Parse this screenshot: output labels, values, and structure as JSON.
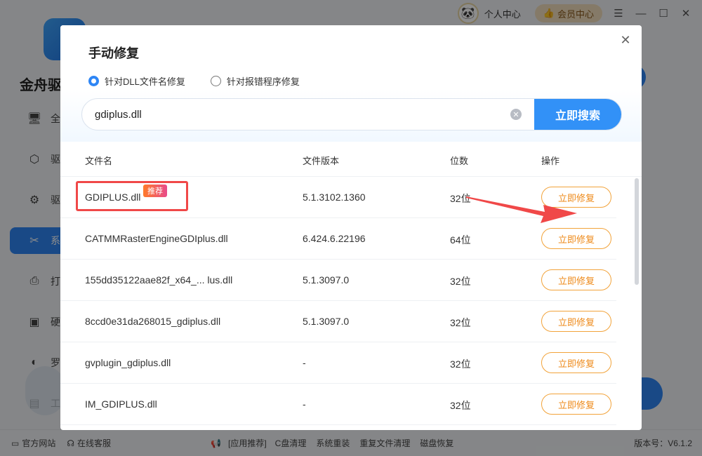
{
  "window": {
    "personal_center": "个人中心",
    "vip_label": "会员中心",
    "menu_icon": "menu-icon",
    "minimize_icon": "minimize-icon",
    "maximize_icon": "maximize-icon",
    "close_icon": "close-icon"
  },
  "app": {
    "title": "金舟驱"
  },
  "sidebar": {
    "items": [
      {
        "label": "全",
        "icon": "monitor-icon"
      },
      {
        "label": "驱",
        "icon": "cube-icon"
      },
      {
        "label": "驱",
        "icon": "gear-search-icon"
      },
      {
        "label": "系",
        "icon": "tools-icon"
      },
      {
        "label": "打",
        "icon": "printer-icon"
      },
      {
        "label": "硬",
        "icon": "chip-icon"
      },
      {
        "label": "罗",
        "icon": "gamepad-icon"
      },
      {
        "label": "工",
        "icon": "toolbox-icon"
      }
    ]
  },
  "footer": {
    "official_site": "官方网站",
    "online_service": "在线客服",
    "recommend": "[应用推荐]",
    "links": [
      "C盘清理",
      "系统重装",
      "重复文件清理",
      "磁盘恢复"
    ],
    "version": "版本号：V6.1.2"
  },
  "modal": {
    "title": "手动修复",
    "radio_options": [
      {
        "label": "针对DLL文件名修复",
        "checked": true
      },
      {
        "label": "针对报错程序修复",
        "checked": false
      }
    ],
    "search": {
      "value": "gdiplus.dll",
      "button": "立即搜索"
    },
    "table": {
      "headers": {
        "name": "文件名",
        "version": "文件版本",
        "bits": "位数",
        "action": "操作"
      },
      "recommend_badge": "推荐",
      "rows": [
        {
          "name": "GDIPLUS.dll",
          "version": "5.1.3102.1360",
          "bits": "32位",
          "action": "立即修复"
        },
        {
          "name": "CATMMRasterEngineGDIplus.dll",
          "version": "6.424.6.22196",
          "bits": "64位",
          "action": "立即修复"
        },
        {
          "name": "155dd35122aae82f_x64_...  lus.dll",
          "version": "5.1.3097.0",
          "bits": "32位",
          "action": "立即修复"
        },
        {
          "name": "8ccd0e31da268015_gdiplus.dll",
          "version": "5.1.3097.0",
          "bits": "32位",
          "action": "立即修复"
        },
        {
          "name": "gvplugin_gdiplus.dll",
          "version": "-",
          "bits": "32位",
          "action": "立即修复"
        },
        {
          "name": "IM_GDIPLUS.dll",
          "version": "-",
          "bits": "32位",
          "action": "立即修复"
        }
      ]
    }
  },
  "colors": {
    "accent": "#2e86f5",
    "orange": "#f2a33a",
    "highlight_red": "#f04848"
  }
}
